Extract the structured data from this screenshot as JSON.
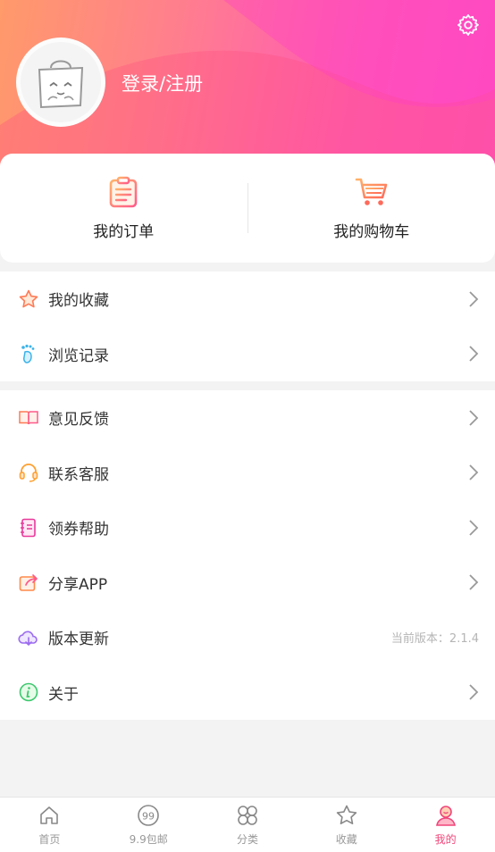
{
  "header": {
    "login_text": "登录/注册"
  },
  "quick": [
    {
      "label": "我的订单",
      "icon": "order-clipboard-icon"
    },
    {
      "label": "我的购物车",
      "icon": "shopping-cart-icon"
    }
  ],
  "menu_group_1": [
    {
      "label": "我的收藏",
      "icon": "star-icon"
    },
    {
      "label": "浏览记录",
      "icon": "footprint-icon"
    }
  ],
  "menu_group_2": [
    {
      "label": "意见反馈",
      "icon": "feedback-book-icon"
    },
    {
      "label": "联系客服",
      "icon": "headset-icon"
    },
    {
      "label": "领券帮助",
      "icon": "notebook-icon"
    },
    {
      "label": "分享APP",
      "icon": "share-icon"
    },
    {
      "label": "版本更新",
      "icon": "cloud-update-icon",
      "version": "当前版本：2.1.4"
    },
    {
      "label": "关于",
      "icon": "info-icon"
    }
  ],
  "tabs": [
    {
      "label": "首页",
      "icon": "home-icon"
    },
    {
      "label": "9.9包邮",
      "icon": "nine-nine-icon"
    },
    {
      "label": "分类",
      "icon": "category-icon"
    },
    {
      "label": "收藏",
      "icon": "star-outline-icon"
    },
    {
      "label": "我的",
      "icon": "profile-icon",
      "active": true
    }
  ],
  "colors": {
    "accent": "#f0467a",
    "header_start": "#ff9a6a",
    "header_end": "#ff4fc0"
  }
}
